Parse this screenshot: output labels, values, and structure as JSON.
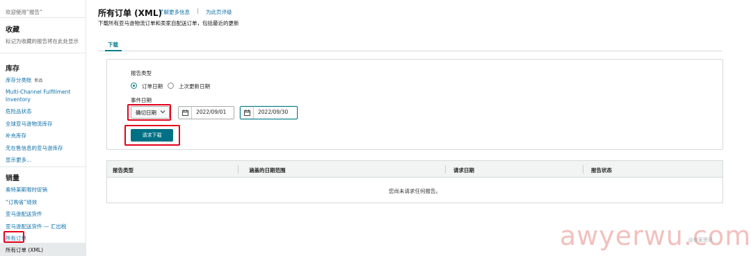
{
  "sidebar": {
    "welcome": "欢迎使用“报告”",
    "favorites_heading": "收藏",
    "favorites_hint": "标记为收藏的报告将在此处显示",
    "inventory_heading": "库存",
    "inventory_items": [
      "库存分类账",
      "Multi-Channel Fulfillment",
      "Inventory",
      "危险品状态",
      "全球亚马逊物流库存",
      "补充库存",
      "无在售信息的亚马逊库存",
      "显示更多..."
    ],
    "new_badge": "新品",
    "sales_heading": "销量",
    "sales_items": [
      "奥特莱斯限时促销",
      "“订购省”绩效",
      "亚马逊配送货件",
      "亚马逊配送货件 — 汇出税",
      "所有订单",
      "所有订单 (XML)"
    ]
  },
  "header": {
    "title": "所有订单 (XML)",
    "learn_more": "了解更多信息",
    "separator": "|",
    "rate_page": "为此页评级",
    "subtitle": "下载所有亚马逊物流订单和卖家自配送订单，包括最近的更新"
  },
  "tabs": [
    {
      "label": "下载"
    }
  ],
  "form": {
    "report_type_label": "报告类型",
    "radio_order_date": "订单日期",
    "radio_last_updated": "上次更新日期",
    "event_date_label": "事件日期",
    "range_select": "确切日期",
    "start_date": "2022/09/01",
    "end_date": "2022/09/30",
    "request_button": "请求下载"
  },
  "table": {
    "columns": [
      "报告类型",
      "涵盖的日期范围",
      "请求日期",
      "报告状态"
    ],
    "empty_message": "您尚未请求任何报告。"
  },
  "watermark": {
    "text": "awyerwu.com",
    "small": "@卖家资讯"
  },
  "colors": {
    "accent": "#007185",
    "link": "#0f6fa8",
    "highlight": "#e3001b"
  }
}
